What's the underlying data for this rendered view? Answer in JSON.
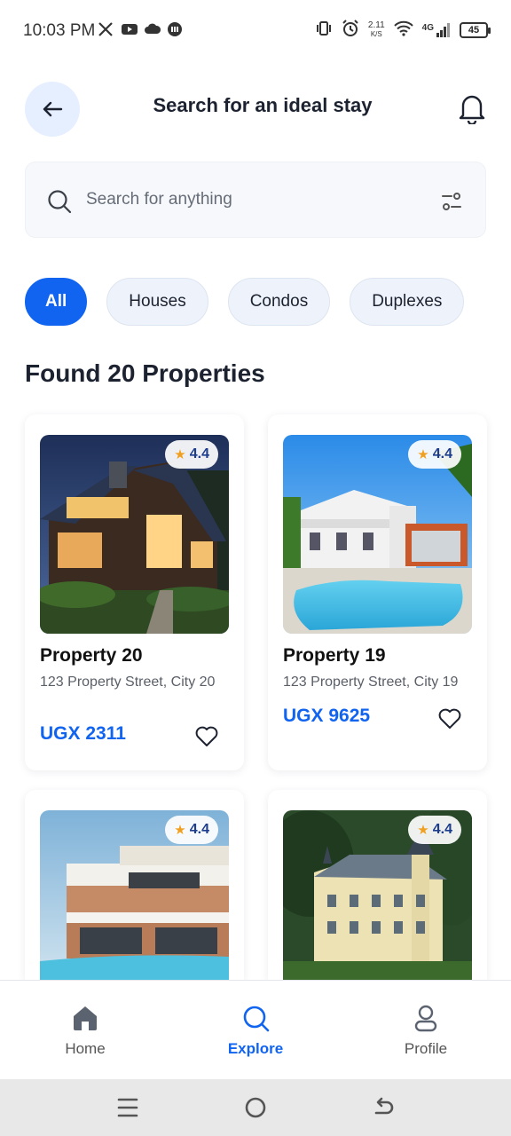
{
  "status_bar": {
    "time": "10:03 PM",
    "speed_value": "2.11",
    "speed_unit": "K/S",
    "network": "4G",
    "battery": "45"
  },
  "header": {
    "title": "Search for an ideal stay"
  },
  "search": {
    "placeholder": "Search for anything",
    "value": ""
  },
  "chips": [
    {
      "label": "All",
      "active": true
    },
    {
      "label": "Houses",
      "active": false
    },
    {
      "label": "Condos",
      "active": false
    },
    {
      "label": "Duplexes",
      "active": false
    }
  ],
  "results_title": "Found 20 Properties",
  "properties": [
    {
      "name": "Property 20",
      "address": "123 Property Street, City 20",
      "price": "UGX 2311",
      "rating": "4.4"
    },
    {
      "name": "Property 19",
      "address": "123 Property Street, City 19",
      "price": "UGX 9625",
      "rating": "4.4"
    },
    {
      "name": "",
      "address": "",
      "price": "",
      "rating": "4.4"
    },
    {
      "name": "",
      "address": "",
      "price": "",
      "rating": "4.4"
    }
  ],
  "bottom_nav": [
    {
      "label": "Home",
      "icon": "home-icon",
      "active": false
    },
    {
      "label": "Explore",
      "icon": "search-icon",
      "active": true
    },
    {
      "label": "Profile",
      "icon": "person-icon",
      "active": false
    }
  ],
  "colors": {
    "accent": "#1064f0",
    "rating_text": "#1c3c8c",
    "star": "#f0a020"
  }
}
